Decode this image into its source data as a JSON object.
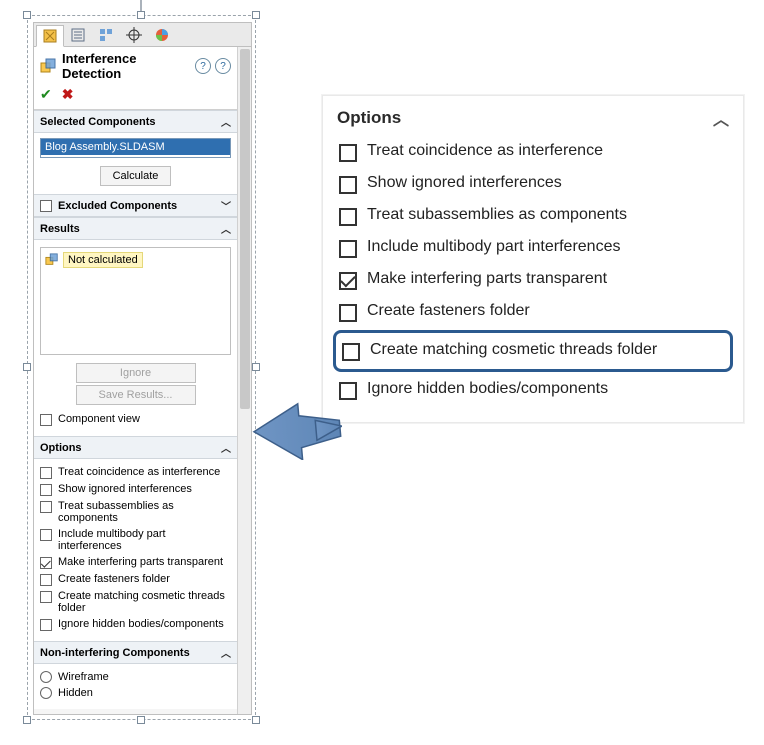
{
  "panel": {
    "title": "Interference Detection",
    "tabs": [
      "feature-tree-icon",
      "properties-icon",
      "config-icon",
      "crosshair-icon",
      "appearance-icon"
    ],
    "selected_components": {
      "heading": "Selected Components",
      "item": "Blog Assembly.SLDASM",
      "calculate_label": "Calculate"
    },
    "excluded": {
      "heading": "Excluded Components"
    },
    "results": {
      "heading": "Results",
      "not_calculated": "Not calculated",
      "ignore_label": "Ignore",
      "save_label": "Save Results...",
      "component_view": "Component view"
    },
    "options": {
      "heading": "Options",
      "items": [
        {
          "label": "Treat coincidence as interference",
          "checked": false
        },
        {
          "label": "Show ignored interferences",
          "checked": false
        },
        {
          "label": "Treat subassemblies as components",
          "checked": false
        },
        {
          "label": "Include multibody part interferences",
          "checked": false
        },
        {
          "label": "Make interfering parts transparent",
          "checked": true
        },
        {
          "label": "Create fasteners folder",
          "checked": false
        },
        {
          "label": "Create matching cosmetic threads folder",
          "checked": false
        },
        {
          "label": "Ignore hidden bodies/components",
          "checked": false
        }
      ]
    },
    "noninterfering": {
      "heading": "Non-interfering Components",
      "items": [
        "Wireframe",
        "Hidden"
      ]
    }
  },
  "callout": {
    "heading": "Options"
  }
}
